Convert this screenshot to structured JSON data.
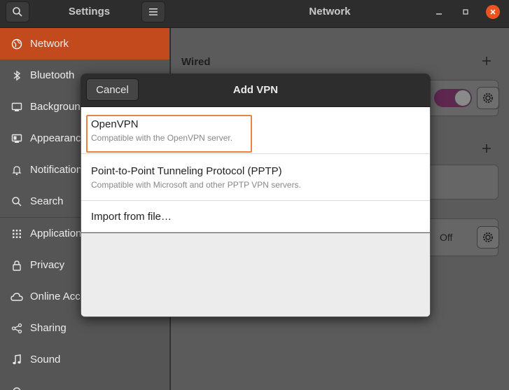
{
  "header": {
    "settings_title": "Settings",
    "panel_title": "Network",
    "search_icon": "search-icon",
    "menu_icon": "hamburger-menu-icon",
    "window_controls": [
      "minimize",
      "maximize",
      "close"
    ]
  },
  "sidebar": {
    "items": [
      {
        "label": "Network",
        "icon": "network-icon",
        "active": true
      },
      {
        "label": "Bluetooth",
        "icon": "bluetooth-icon"
      },
      {
        "label": "Background",
        "icon": "background-icon"
      },
      {
        "label": "Appearance",
        "icon": "appearance-icon"
      },
      {
        "label": "Notifications",
        "icon": "bell-icon"
      },
      {
        "label": "Search",
        "icon": "search-icon"
      },
      {
        "label": "Applications",
        "icon": "grid-icon"
      },
      {
        "label": "Privacy",
        "icon": "lock-icon"
      },
      {
        "label": "Online Accounts",
        "icon": "cloud-icon"
      },
      {
        "label": "Sharing",
        "icon": "share-icon"
      },
      {
        "label": "Sound",
        "icon": "music-note-icon"
      }
    ]
  },
  "main": {
    "wired_title": "Wired",
    "off_label": "Off"
  },
  "dialog": {
    "title": "Add VPN",
    "cancel_label": "Cancel",
    "options": [
      {
        "title": "OpenVPN",
        "subtitle": "Compatible with the OpenVPN server."
      },
      {
        "title": "Point-to-Point Tunneling Protocol (PPTP)",
        "subtitle": "Compatible with Microsoft and other PPTP VPN servers."
      },
      {
        "title": "Import from file…"
      }
    ]
  },
  "colors": {
    "accent": "#e95420",
    "sidebar_active": "#c34a1c",
    "highlight_box": "#e8843e",
    "toggle_on": "#5e2750"
  }
}
